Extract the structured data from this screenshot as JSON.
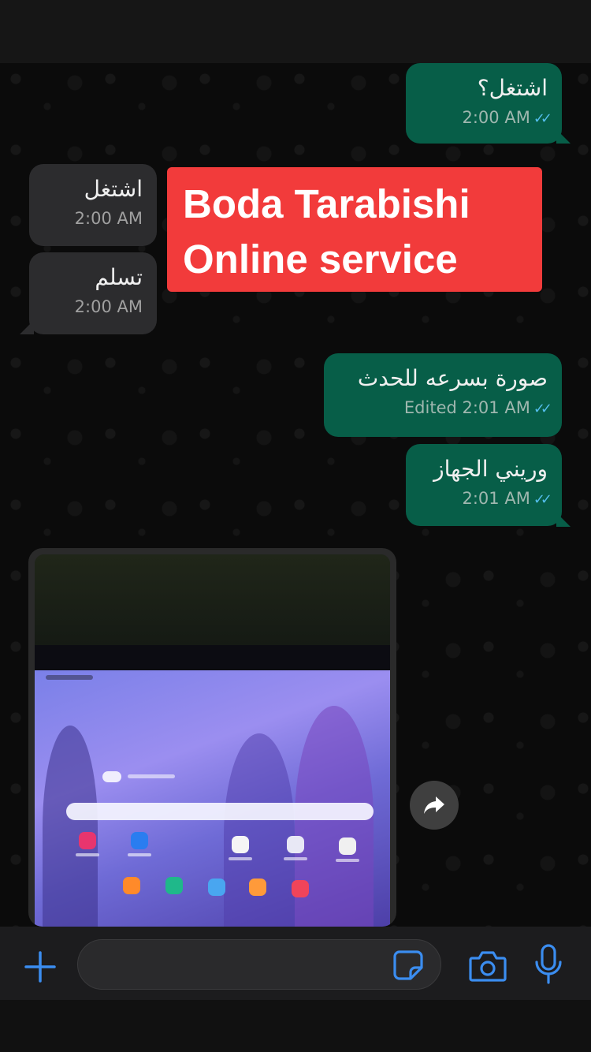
{
  "overlay": {
    "line1": "Boda Tarabishi",
    "line2": "Online service"
  },
  "messages": [
    {
      "direction": "out",
      "text": "اشتغل؟",
      "time": "2:00 AM",
      "status": "read"
    },
    {
      "direction": "in",
      "text": "اشتغل",
      "time": "2:00 AM"
    },
    {
      "direction": "in",
      "text": "تسلم",
      "time": "2:00 AM"
    },
    {
      "direction": "out",
      "text": "صورة بسرعه للحدث",
      "time": "Edited 2:01 AM",
      "status": "read"
    },
    {
      "direction": "out",
      "text": "وريني الجهاز",
      "time": "2:01 AM",
      "status": "read"
    }
  ],
  "image_message": {
    "direction": "in",
    "content": "photo of a tablet home screen"
  },
  "composer": {
    "placeholder": "",
    "value": ""
  },
  "colors": {
    "outgoing_bubble": "#075e48",
    "incoming_bubble": "#2c2c2e",
    "read_ticks": "#53bdeb",
    "accent_icons": "#3b8df0",
    "banner": "#f23b3b"
  },
  "icons": [
    "plus-icon",
    "sticker-icon",
    "camera-icon",
    "microphone-icon",
    "forward-icon",
    "double-check-icon"
  ]
}
